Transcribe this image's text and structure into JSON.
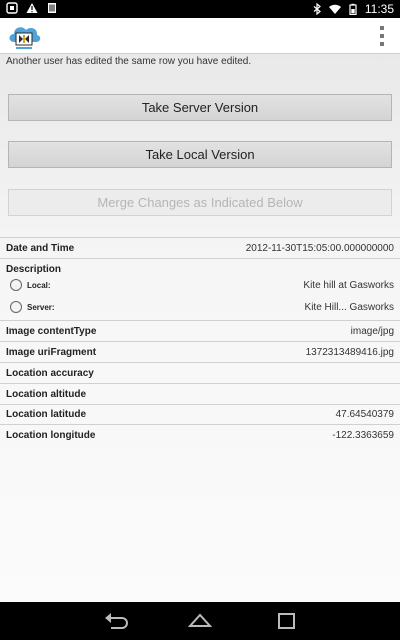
{
  "status": {
    "time": "11:35"
  },
  "header": {
    "logo_alt": "ODK"
  },
  "notice": "Another user has edited the same row you have edited.",
  "buttons": {
    "server": "Take Server Version",
    "local": "Take Local Version",
    "merge": "Merge Changes as Indicated Below"
  },
  "fields": {
    "datetime": {
      "label": "Date and Time",
      "value": "2012-11-30T15:05:00.000000000"
    },
    "description": {
      "label": "Description",
      "local_label": "Local:",
      "local_value": "Kite hill at Gasworks",
      "server_label": "Server:",
      "server_value": "Kite Hill... Gasworks"
    },
    "content_type": {
      "label": "Image contentType",
      "value": "image/jpg"
    },
    "uri_fragment": {
      "label": "Image uriFragment",
      "value": "1372313489416.jpg"
    },
    "accuracy": {
      "label": "Location accuracy",
      "value": ""
    },
    "altitude": {
      "label": "Location altitude",
      "value": ""
    },
    "latitude": {
      "label": "Location latitude",
      "value": "47.64540379"
    },
    "longitude": {
      "label": "Location longitude",
      "value": "-122.3363659"
    }
  },
  "icons": {
    "status_left": [
      "notification-icon",
      "warning-icon",
      "sim-icon"
    ],
    "status_right": [
      "bluetooth-icon",
      "wifi-icon",
      "battery-icon"
    ],
    "nav": [
      "back-icon",
      "home-icon",
      "recents-icon"
    ]
  }
}
